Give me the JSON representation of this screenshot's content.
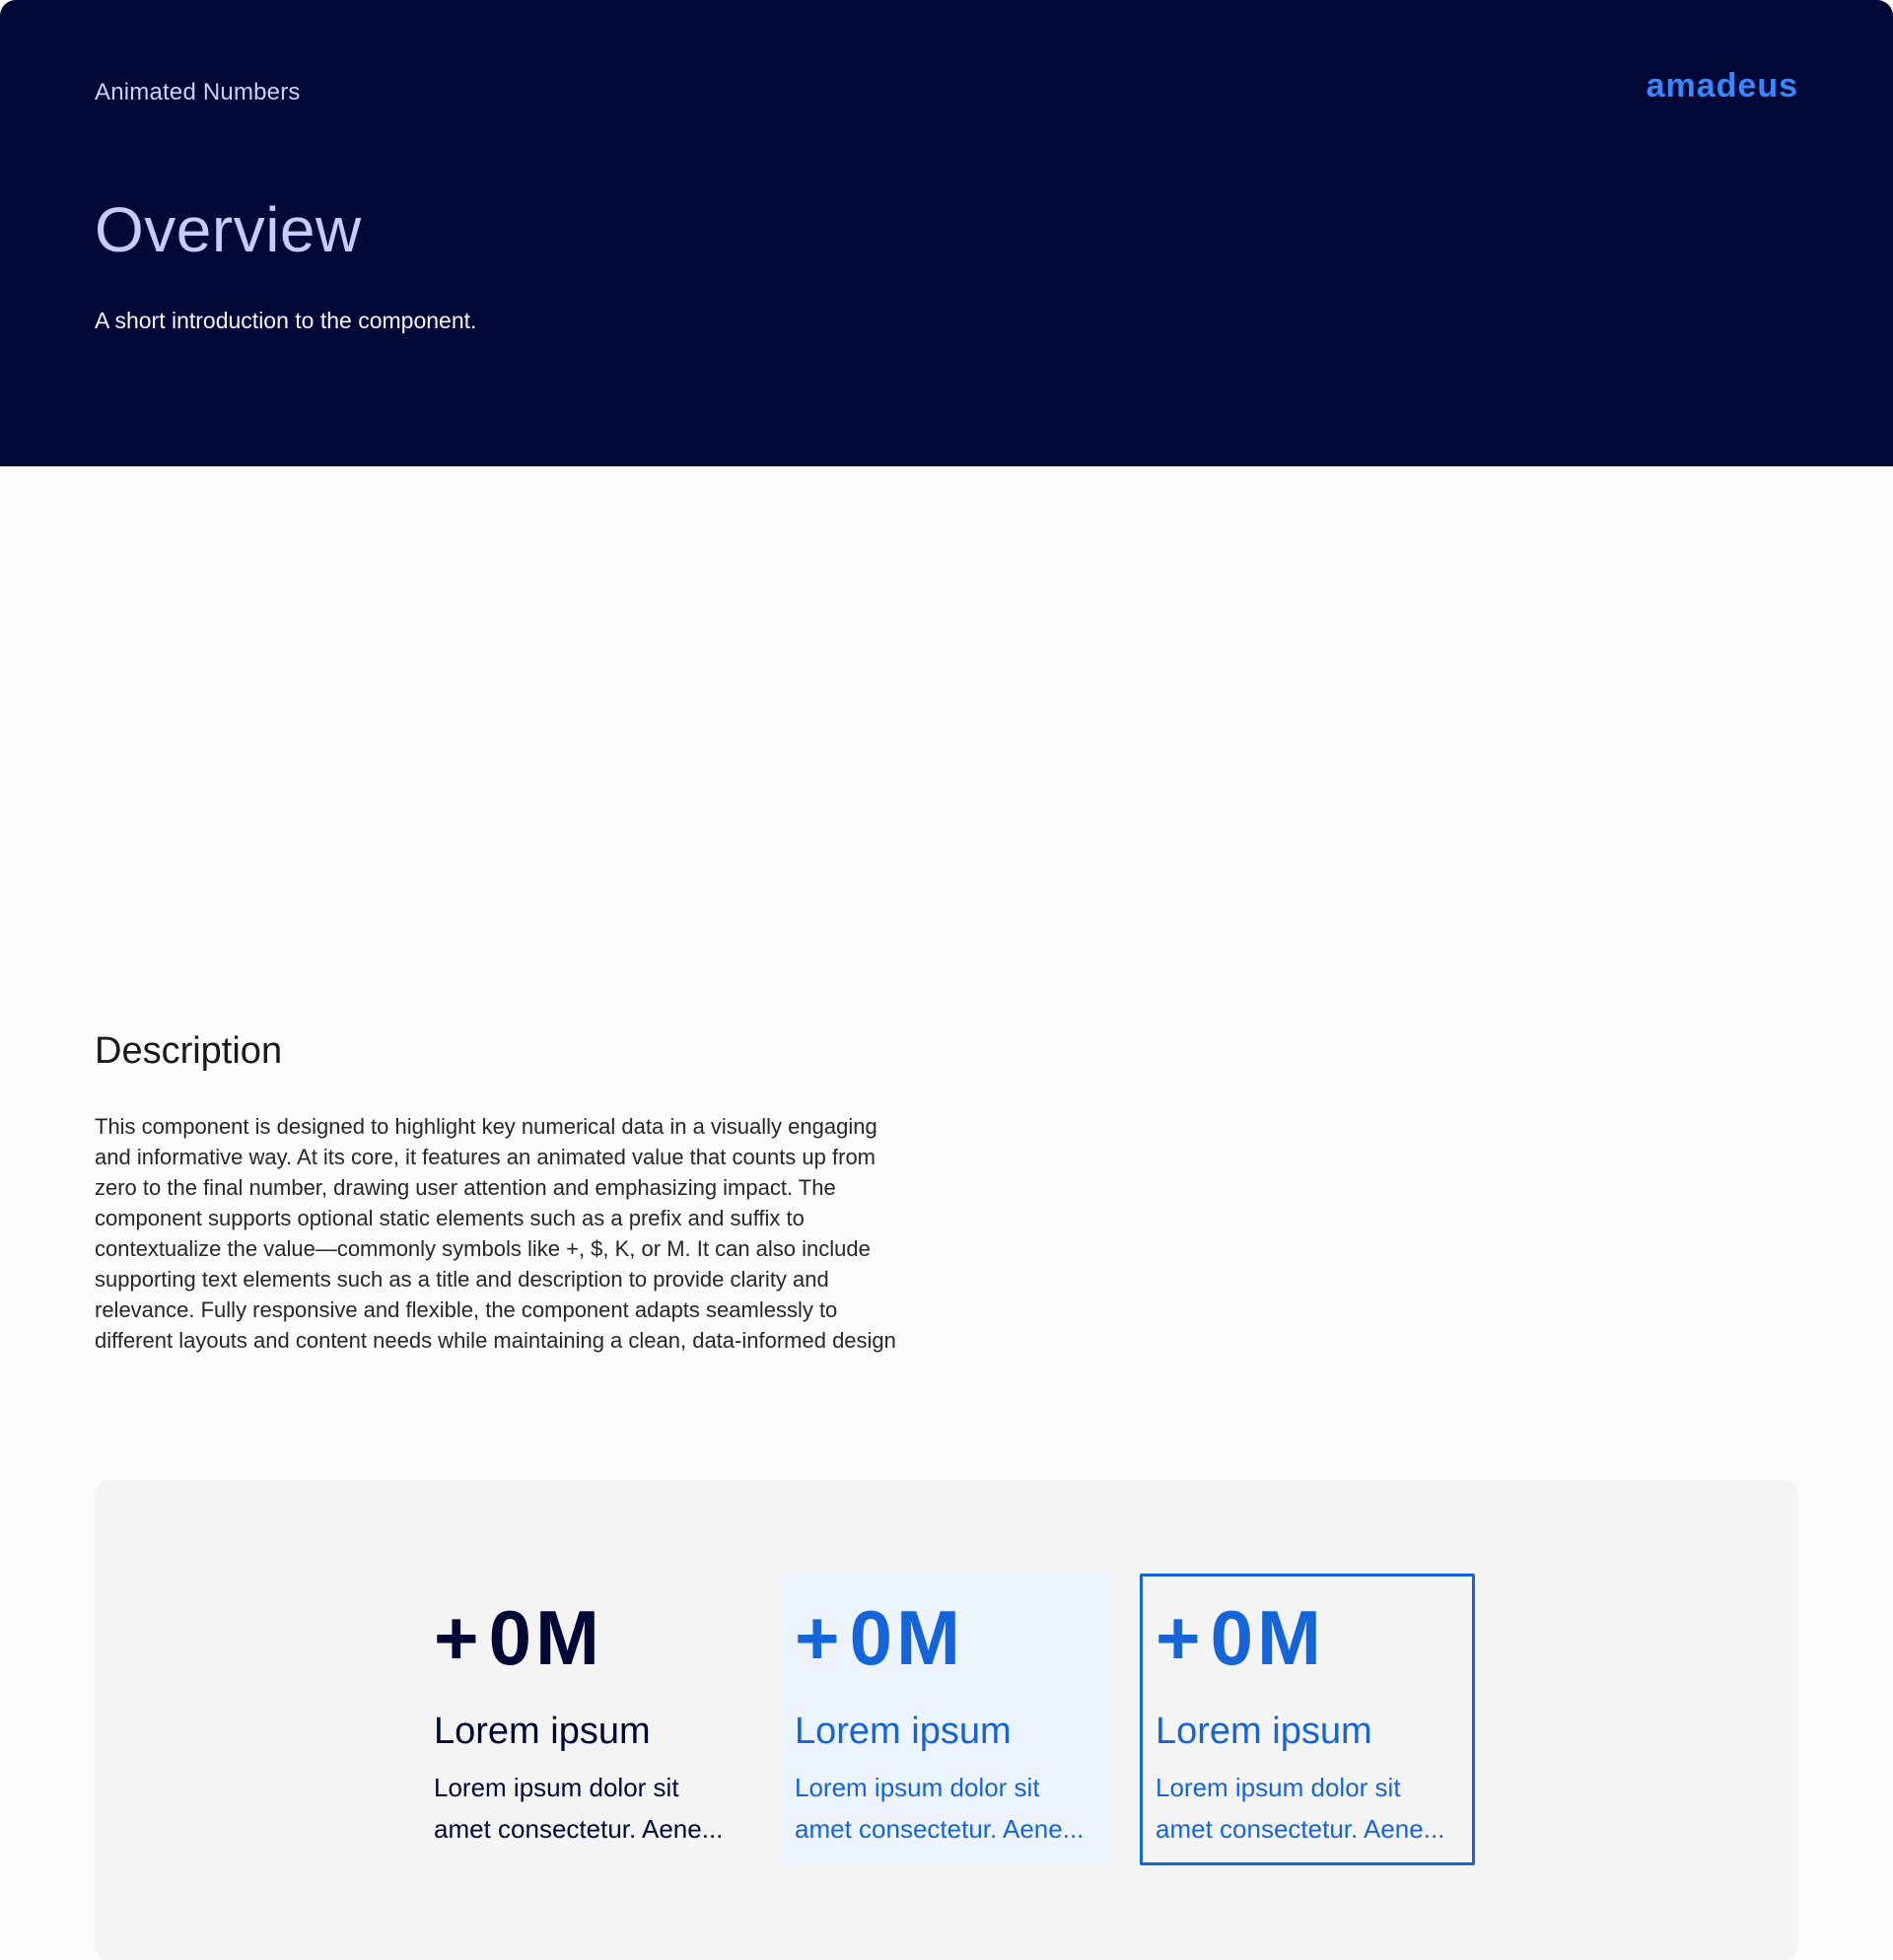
{
  "header": {
    "eyebrow": "Animated Numbers",
    "brand": "amadeus",
    "title": "Overview",
    "subtitle": "A short introduction to the component."
  },
  "description": {
    "heading": "Description",
    "body": "This component is designed to highlight key numerical data in a visually engaging and informative way. At its core, it features an animated value that counts up from zero to the final number, drawing user attention and emphasizing impact. The component supports optional static elements such as a prefix and suffix to contextualize the value—commonly symbols like +, $, K, or M. It can also include supporting text elements such as a title and description to provide clarity and relevance. Fully responsive and flexible, the component adapts seamlessly to different layouts and content needs while maintaining a clean, data-informed design"
  },
  "cards": [
    {
      "prefix": "+",
      "value": "0",
      "suffix": "M",
      "title": "Lorem ipsum",
      "desc_line1": "Lorem ipsum dolor sit",
      "desc_line2": "amet consectetur. Aene..."
    },
    {
      "prefix": "+",
      "value": "0",
      "suffix": "M",
      "title": "Lorem ipsum",
      "desc_line1": "Lorem ipsum dolor sit",
      "desc_line2": "amet consectetur. Aene..."
    },
    {
      "prefix": "+",
      "value": "0",
      "suffix": "M",
      "title": "Lorem ipsum",
      "desc_line1": "Lorem ipsum dolor sit",
      "desc_line2": "amet consectetur. Aene..."
    }
  ],
  "colors": {
    "header_bg": "#000835",
    "brand": "#3a86ff",
    "accent": "#1565d8",
    "dark_text": "#000835",
    "panel_bg": "#f4f4f5",
    "highlight_bg": "#edf4fd"
  }
}
